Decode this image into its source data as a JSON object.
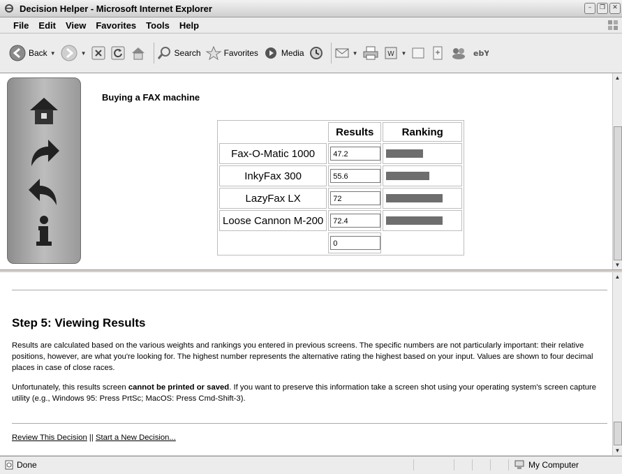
{
  "window": {
    "title": "Decision Helper - Microsoft Internet Explorer"
  },
  "menu": [
    "File",
    "Edit",
    "View",
    "Favorites",
    "Tools",
    "Help"
  ],
  "toolbar": {
    "back": "Back",
    "search": "Search",
    "favorites": "Favorites",
    "media": "Media"
  },
  "page": {
    "heading": "Buying a FAX machine",
    "table": {
      "headers": [
        "Results",
        "Ranking"
      ],
      "rows": [
        {
          "name": "Fax-O-Matic 1000",
          "result": "47.2",
          "rank": 0.472
        },
        {
          "name": "InkyFax 300",
          "result": "55.6",
          "rank": 0.556
        },
        {
          "name": "LazyFax LX",
          "result": "72",
          "rank": 0.72
        },
        {
          "name": "Loose Cannon M-200",
          "result": "72.4",
          "rank": 0.724
        },
        {
          "name": "",
          "result": "0",
          "rank": 0
        }
      ]
    }
  },
  "help": {
    "title": "Step 5: Viewing Results",
    "para1": "Results are calculated based on the various weights and rankings you entered in previous screens. The specific numbers are not particularly important: their relative positions, however, are what you're looking for. The highest number represents the alternative rating the highest based on your input. Values are shown to four decimal places in case of close races.",
    "para2_before": "Unfortunately, this results screen ",
    "para2_bold": "cannot be printed or saved",
    "para2_after": ". If you want to preserve this information take a screen shot using your operating system's screen capture utility (e.g., Windows 95: Press PrtSc; MacOS: Press Cmd-Shift-3).",
    "link_review": "Review This Decision",
    "link_sep": " || ",
    "link_new": "Start a New Decision..."
  },
  "status": {
    "text": "Done",
    "zone": "My Computer"
  }
}
